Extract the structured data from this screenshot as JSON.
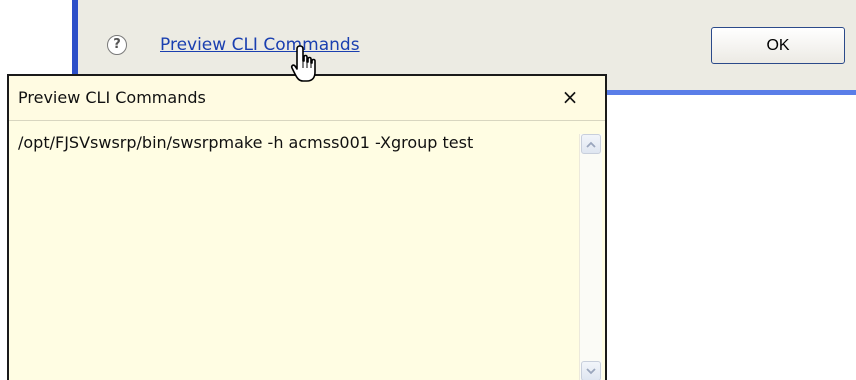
{
  "dialog": {
    "help_icon_glyph": "?",
    "preview_link_label": "Preview CLI Commands",
    "ok_label": "OK"
  },
  "popup": {
    "title": "Preview CLI Commands",
    "close_glyph": "×",
    "command": "/opt/FJSVswsrp/bin/swsrpmake -h acmss001 -Xgroup test"
  },
  "colors": {
    "dialog_bg": "#ecebe3",
    "dialog_border": "#2c4fc8",
    "link": "#1a3fb0",
    "popup_bg": "#fffde0"
  }
}
